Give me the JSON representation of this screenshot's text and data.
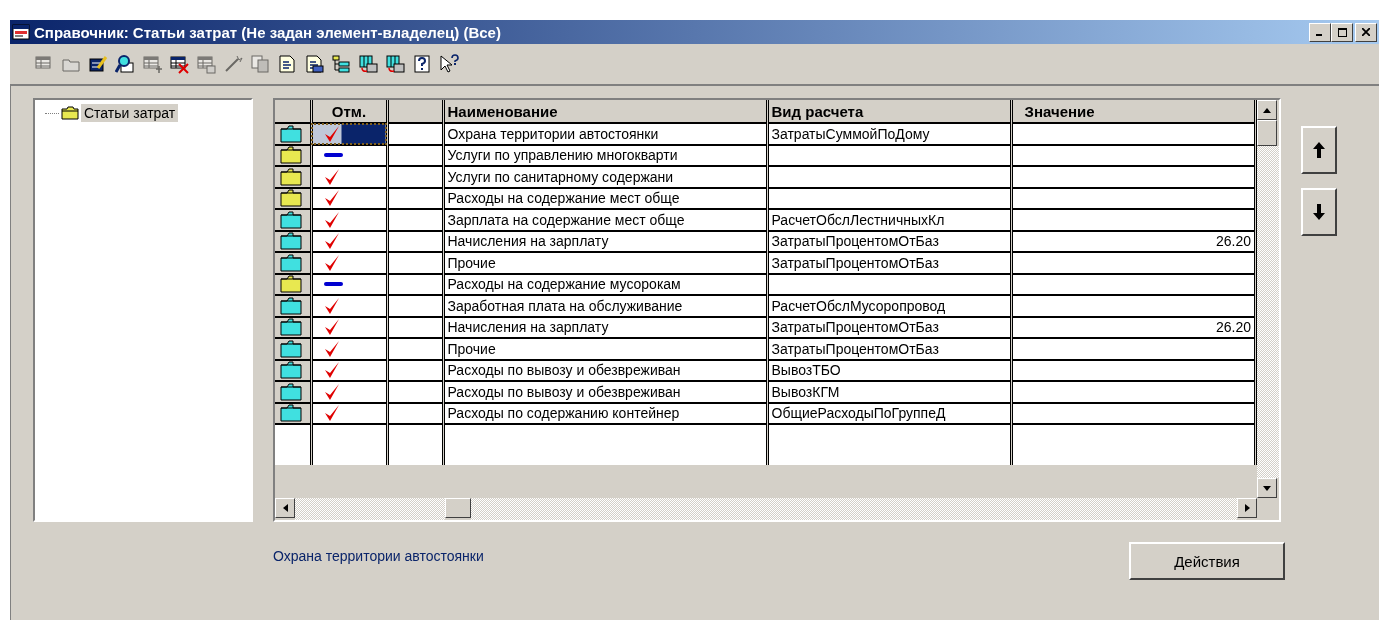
{
  "window": {
    "title": "Справочник: Статьи затрат (Не задан элемент-владелец) (Все)"
  },
  "toolbar": [
    {
      "kind": "table",
      "disabled": true
    },
    {
      "kind": "folder",
      "disabled": true
    },
    {
      "kind": "edit",
      "disabled": false
    },
    {
      "kind": "find",
      "disabled": false
    },
    {
      "kind": "add",
      "disabled": true
    },
    {
      "kind": "delete",
      "disabled": false
    },
    {
      "kind": "copyrow",
      "disabled": true
    },
    {
      "kind": "wand",
      "disabled": true
    },
    {
      "kind": "copy",
      "disabled": true
    },
    {
      "kind": "document",
      "disabled": false
    },
    {
      "kind": "print",
      "disabled": false
    },
    {
      "kind": "tree",
      "disabled": false
    },
    {
      "kind": "move",
      "disabled": false
    },
    {
      "kind": "transfer",
      "disabled": false
    },
    {
      "kind": "help",
      "disabled": false
    },
    {
      "kind": "pointer",
      "disabled": false
    }
  ],
  "tree": {
    "items": [
      {
        "label": "Статьи затрат",
        "selected": true
      }
    ]
  },
  "table": {
    "columns": [
      "Отм.",
      "Наименование",
      "Вид расчета",
      "Значение"
    ],
    "rows": [
      {
        "kind": "element",
        "checked": true,
        "selected": true,
        "name": "Охрана территории автостоянки",
        "calc": "ЗатратыСуммойПоДому",
        "value": ""
      },
      {
        "kind": "group",
        "checked": false,
        "selected": false,
        "name": "Услуги по управлению многокварти",
        "calc": "",
        "value": ""
      },
      {
        "kind": "group",
        "checked": true,
        "selected": false,
        "name": "Услуги по санитарному содержани",
        "calc": "",
        "value": ""
      },
      {
        "kind": "group",
        "checked": true,
        "selected": false,
        "name": "Расходы на содержание мест обще",
        "calc": "",
        "value": ""
      },
      {
        "kind": "element",
        "checked": true,
        "selected": false,
        "name": "Зарплата на содержание мест обще",
        "calc": "РасчетОбслЛестничныхКл",
        "value": ""
      },
      {
        "kind": "element",
        "checked": true,
        "selected": false,
        "name": "Начисления на зарплату",
        "calc": "ЗатратыПроцентомОтБаз",
        "value": "26.20"
      },
      {
        "kind": "element",
        "checked": true,
        "selected": false,
        "name": "Прочие",
        "calc": "ЗатратыПроцентомОтБаз",
        "value": ""
      },
      {
        "kind": "group",
        "checked": false,
        "selected": false,
        "name": "Расходы на содержание мусорокам",
        "calc": "",
        "value": ""
      },
      {
        "kind": "element",
        "checked": true,
        "selected": false,
        "name": "Заработная плата на обслуживание",
        "calc": "РасчетОбслМусоропровод",
        "value": ""
      },
      {
        "kind": "element",
        "checked": true,
        "selected": false,
        "name": "Начисления на зарплату",
        "calc": "ЗатратыПроцентомОтБаз",
        "value": "26.20"
      },
      {
        "kind": "element",
        "checked": true,
        "selected": false,
        "name": "Прочие",
        "calc": "ЗатратыПроцентомОтБаз",
        "value": ""
      },
      {
        "kind": "element",
        "checked": true,
        "selected": false,
        "name": "Расходы по вывозу и обезвреживан",
        "calc": "ВывозТБО",
        "value": ""
      },
      {
        "kind": "element",
        "checked": true,
        "selected": false,
        "name": "Расходы по вывозу и обезвреживан",
        "calc": "ВывозКГМ",
        "value": ""
      },
      {
        "kind": "element",
        "checked": true,
        "selected": false,
        "name": "Расходы по содержанию контейнер",
        "calc": "ОбщиеРасходыПоГруппеД",
        "value": ""
      }
    ]
  },
  "status_text": "Охрана территории автостоянки",
  "actions_button": "Действия"
}
